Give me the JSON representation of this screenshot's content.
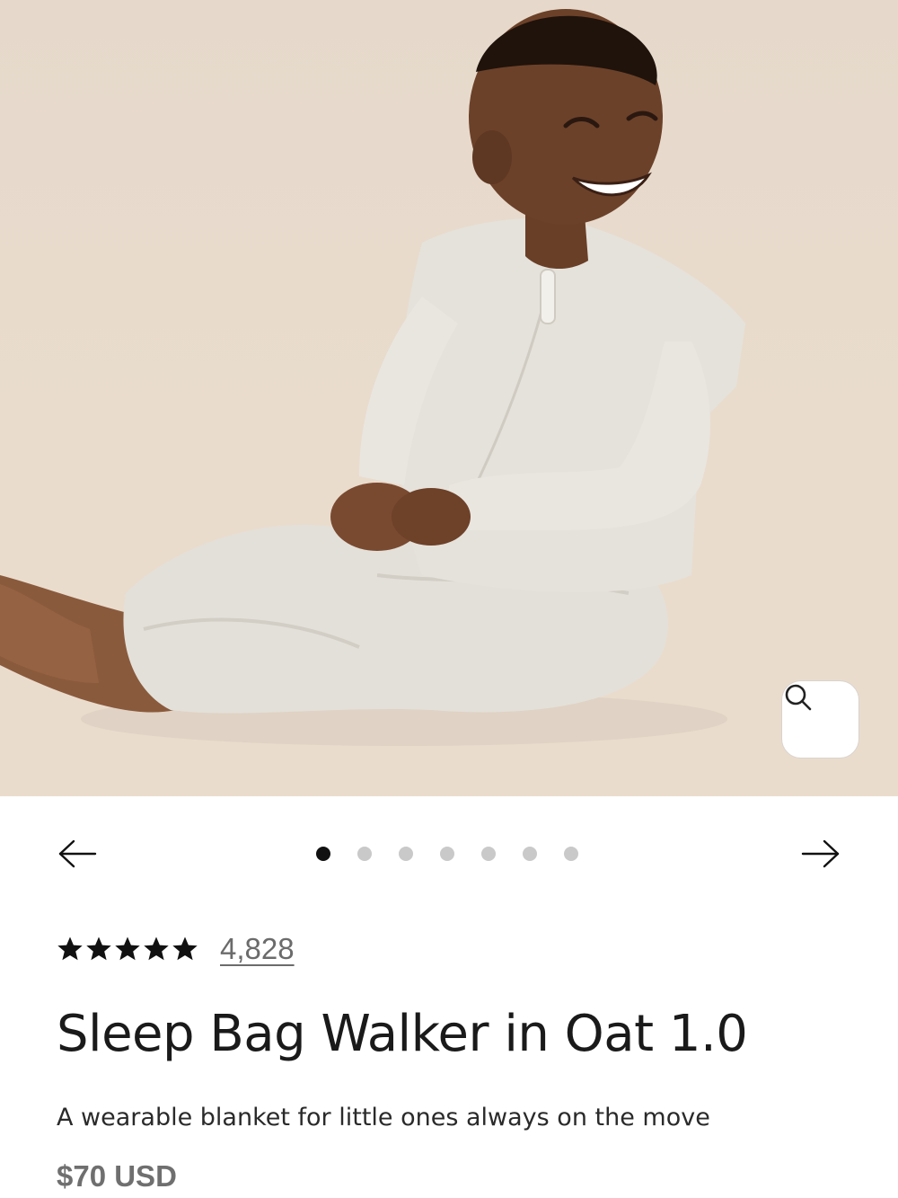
{
  "product": {
    "image_alt": "Sleep Bag Walker in Oat 1.0",
    "rating_icon": "star-icon",
    "rating_stars": 5,
    "review_count": "4,828",
    "title": "Sleep Bag Walker in Oat 1.0",
    "subtitle": "A wearable blanket for little ones always on the move",
    "price": "$70 USD"
  },
  "carousel": {
    "slide_count": 7,
    "active_index": 0,
    "prev_icon": "arrow-left-icon",
    "next_icon": "arrow-right-icon",
    "zoom_icon": "search-icon"
  },
  "colors": {
    "background_photo": "#e6d9cb",
    "garment": "#e4e1da",
    "dot_active": "#111111",
    "dot_inactive": "#c9c9c9",
    "price_text": "#6f6f6f"
  }
}
